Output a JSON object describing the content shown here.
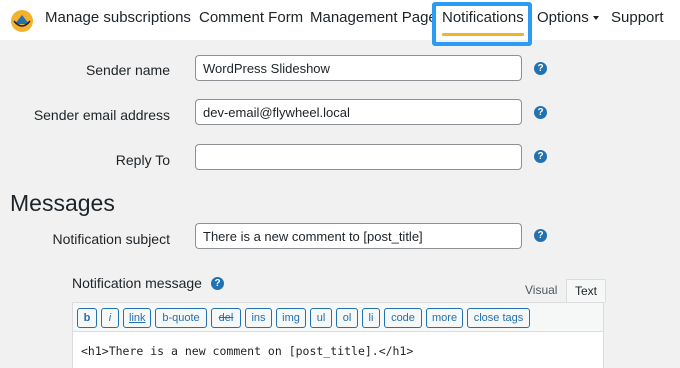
{
  "nav": {
    "items": [
      "Manage subscriptions",
      "Comment Form",
      "Management Page",
      "Notifications",
      "Options",
      "Support"
    ],
    "active": "Notifications",
    "accent_color": "#f0b429",
    "highlight_color": "#2b9bf4"
  },
  "form": {
    "sender_name": {
      "label": "Sender name",
      "value": "WordPress Slideshow"
    },
    "sender_email": {
      "label": "Sender email address",
      "value": "dev-email@flywheel.local"
    },
    "reply_to": {
      "label": "Reply To",
      "value": ""
    }
  },
  "messages": {
    "title": "Messages",
    "subject": {
      "label": "Notification subject",
      "value": "There is a new comment to [post_title]"
    },
    "message": {
      "label": "Notification message",
      "tabs": [
        "Visual",
        "Text"
      ],
      "active_tab": "Text",
      "toolbar": [
        "b",
        "i",
        "link",
        "b-quote",
        "del",
        "ins",
        "img",
        "ul",
        "ol",
        "li",
        "code",
        "more",
        "close tags"
      ],
      "content": "<h1>There is a new comment on [post_title].</h1>"
    }
  },
  "help_icon": "question-mark-icon"
}
